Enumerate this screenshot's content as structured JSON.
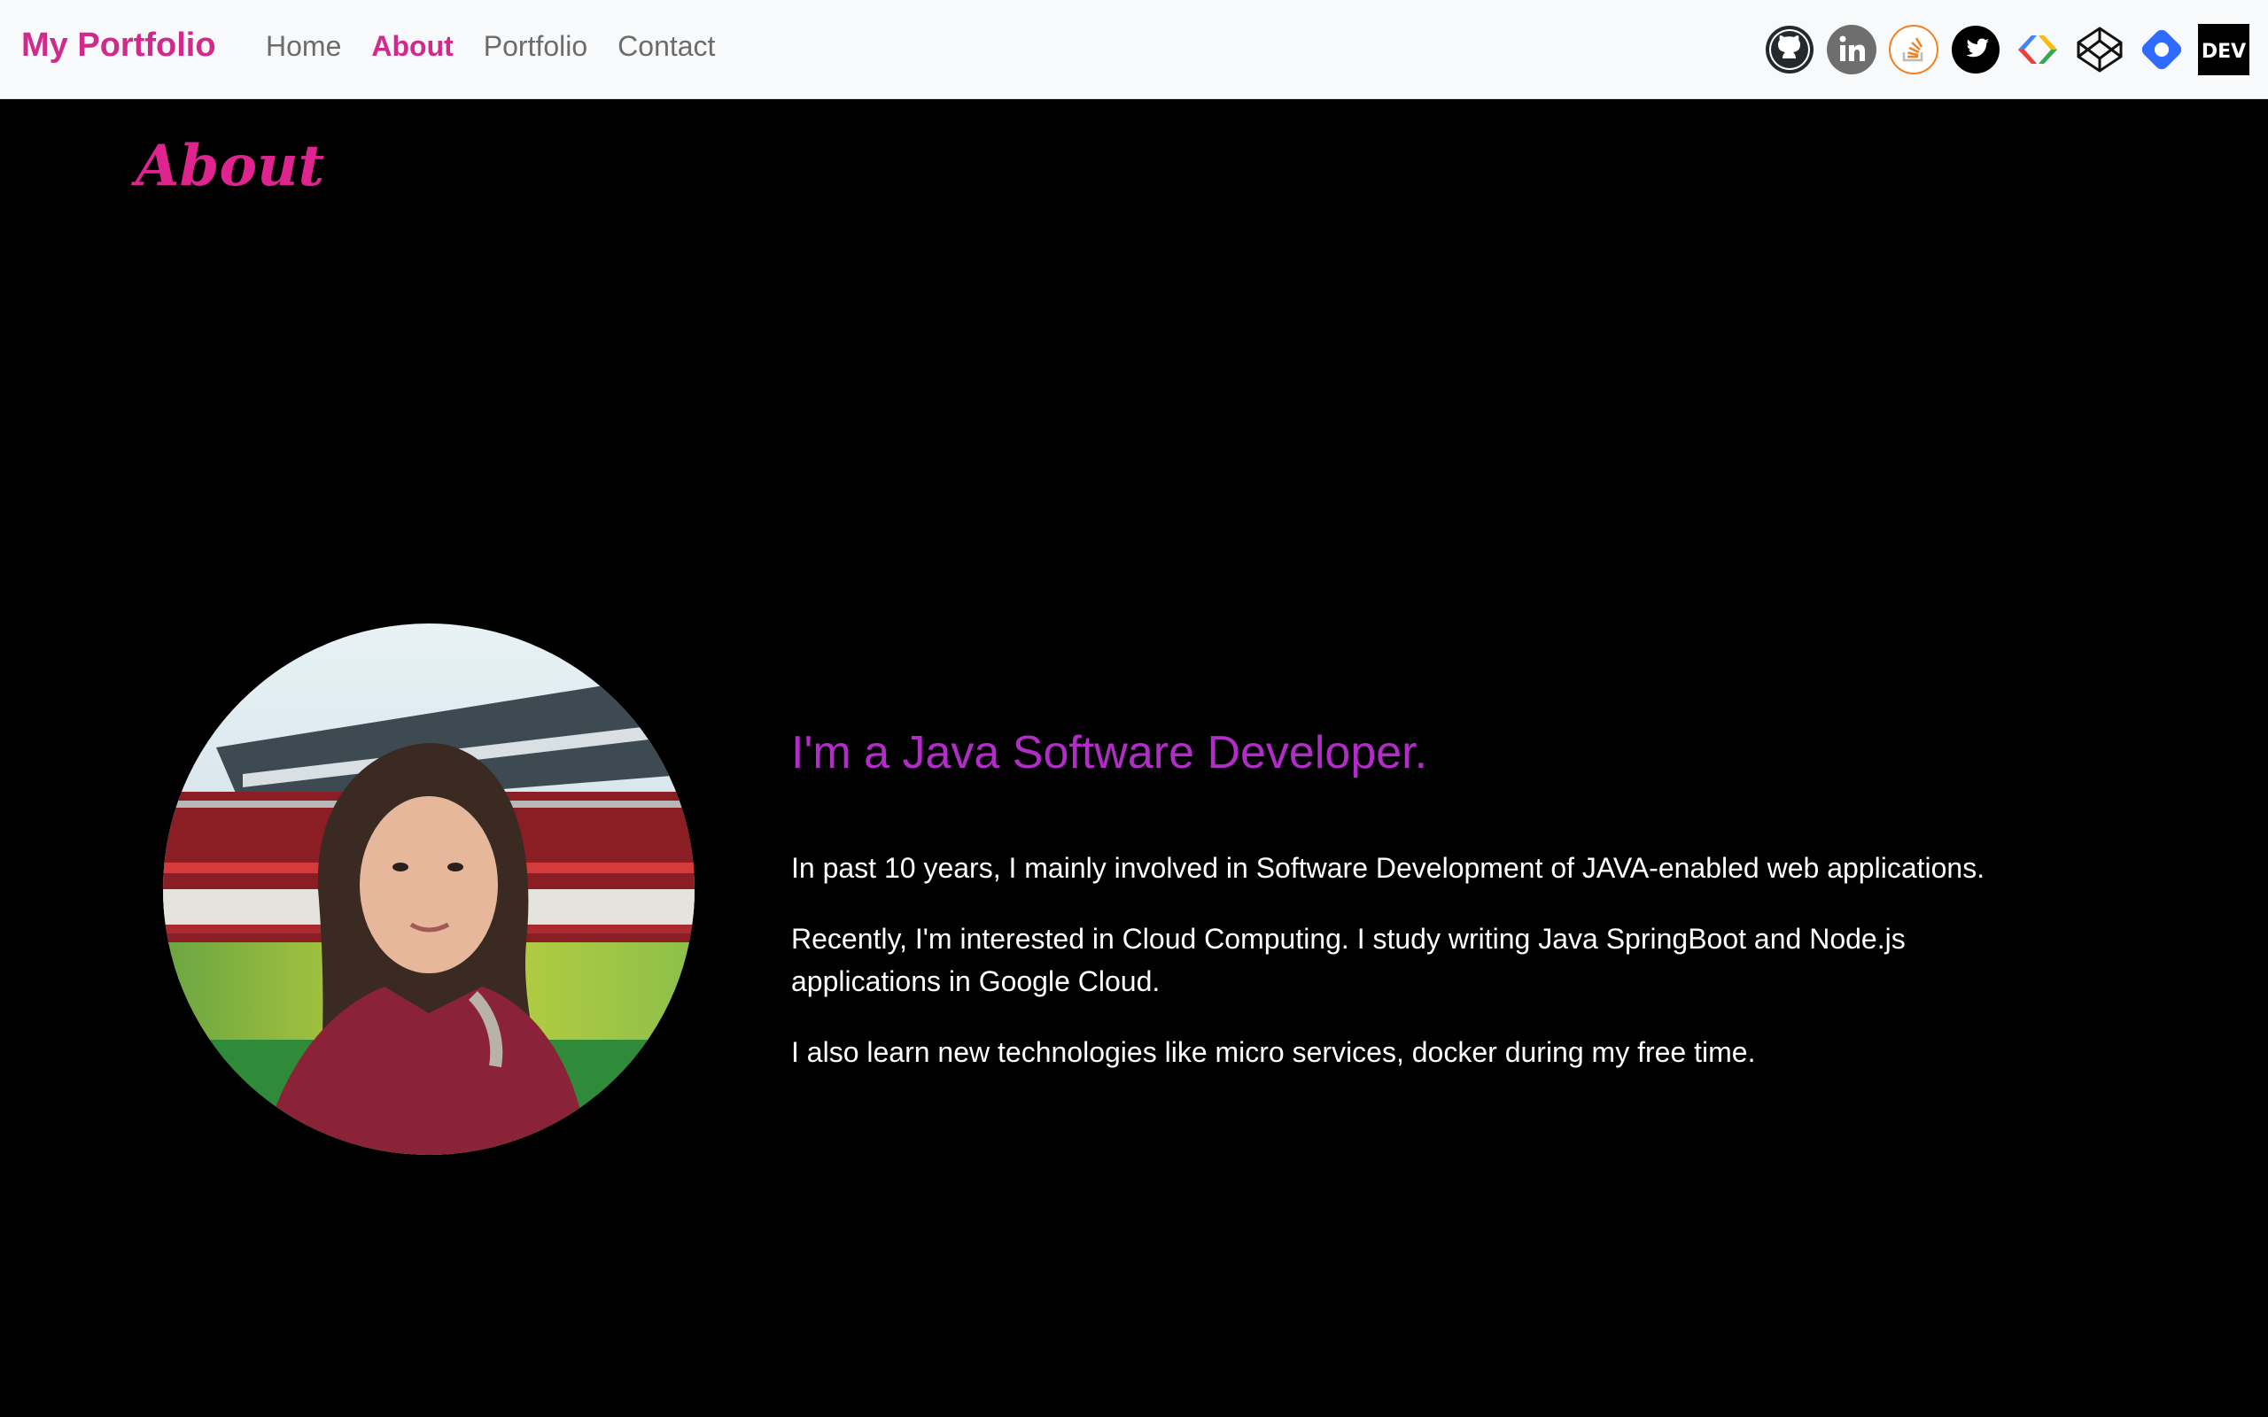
{
  "nav": {
    "brand": "My Portfolio",
    "links": [
      "Home",
      "About",
      "Portfolio",
      "Contact"
    ],
    "active": "About",
    "brand_color": "#d02a8c"
  },
  "social": [
    {
      "icon": "github-icon"
    },
    {
      "icon": "linkedin-icon"
    },
    {
      "icon": "stackoverflow-icon"
    },
    {
      "icon": "twitter-icon"
    },
    {
      "icon": "google-developers-icon"
    },
    {
      "icon": "codepen-icon"
    },
    {
      "icon": "jira-icon"
    },
    {
      "icon": "dev-icon",
      "text": "DEV"
    }
  ],
  "about": {
    "title": "About",
    "headline": "I'm a Java Software Developer.",
    "paragraphs": [
      "In past 10 years, I mainly involved in Software Development of JAVA-enabled web applications.",
      "Recently, I'm interested in Cloud Computing. I study writing Java SpringBoot and Node.js applications in Google Cloud.",
      "I also learn new technologies like micro services, docker during my free time."
    ],
    "headline_color": "#b22cc7",
    "title_color": "#e0248f"
  }
}
